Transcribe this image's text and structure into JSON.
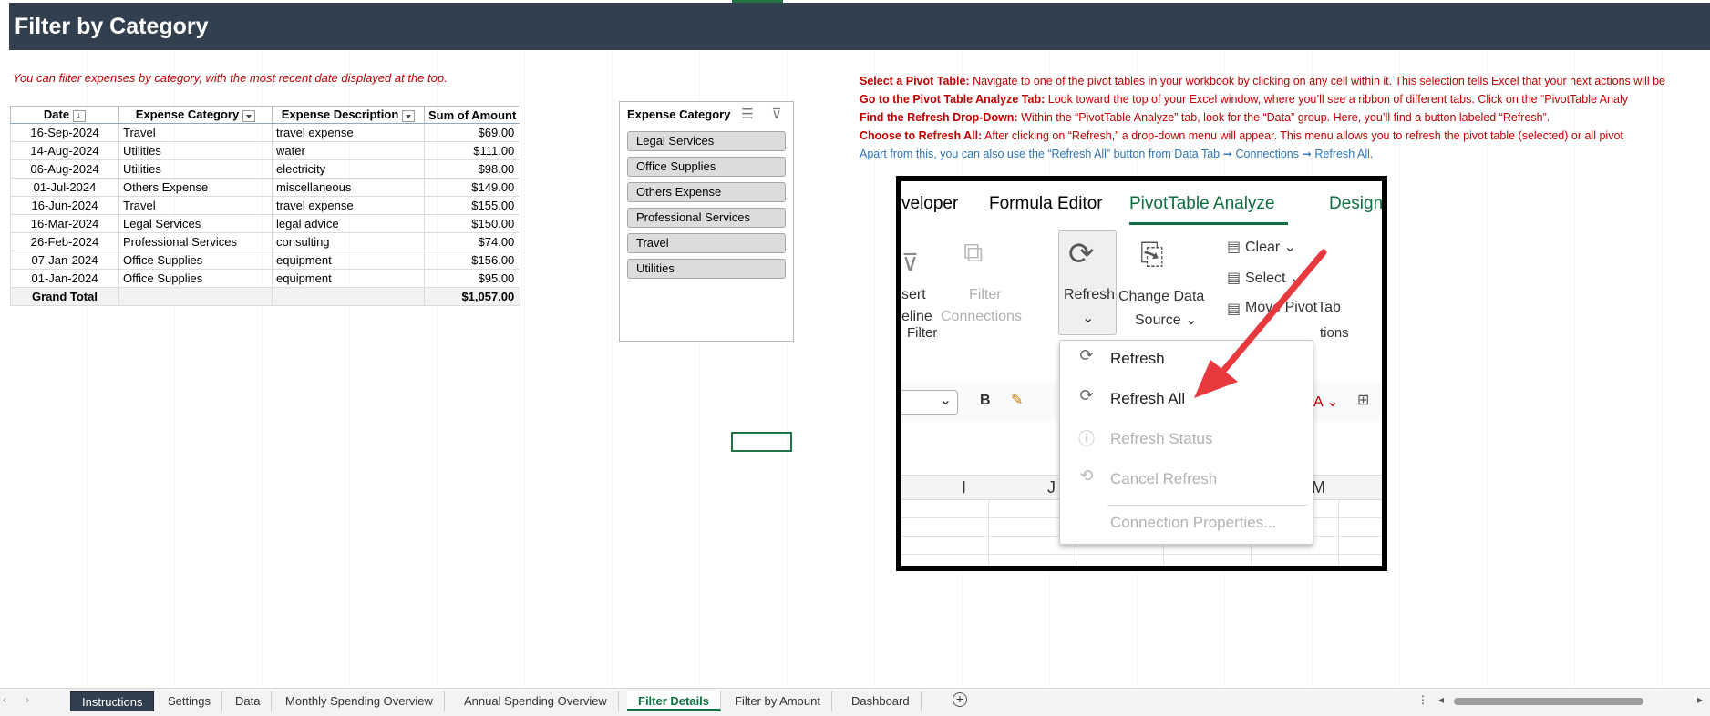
{
  "title": "Filter by Category",
  "subtitle": "You can filter expenses by category, with the most recent date displayed at the top.",
  "pivot": {
    "headers": [
      "Date",
      "Expense Category",
      "Expense Description",
      "Sum of Amount"
    ],
    "rows": [
      [
        "16-Sep-2024",
        "Travel",
        "travel expense",
        "$69.00"
      ],
      [
        "14-Aug-2024",
        "Utilities",
        "water",
        "$111.00"
      ],
      [
        "06-Aug-2024",
        "Utilities",
        "electricity",
        "$98.00"
      ],
      [
        "01-Jul-2024",
        "Others Expense",
        "miscellaneous",
        "$149.00"
      ],
      [
        "16-Jun-2024",
        "Travel",
        "travel expense",
        "$155.00"
      ],
      [
        "16-Mar-2024",
        "Legal Services",
        "legal advice",
        "$150.00"
      ],
      [
        "26-Feb-2024",
        "Professional Services",
        "consulting",
        "$74.00"
      ],
      [
        "07-Jan-2024",
        "Office Supplies",
        "equipment",
        "$156.00"
      ],
      [
        "01-Jan-2024",
        "Office Supplies",
        "equipment",
        "$95.00"
      ]
    ],
    "total_label": "Grand Total",
    "total_value": "$1,057.00"
  },
  "slicer": {
    "title": "Expense Category",
    "items": [
      "Legal Services",
      "Office Supplies",
      "Others Expense",
      "Professional Services",
      "Travel",
      "Utilities"
    ]
  },
  "instructions": [
    {
      "bold": "Select a Pivot Table:",
      "text": " Navigate to one of the pivot tables in your workbook by clicking on any cell within it. This selection tells Excel that your next actions will be"
    },
    {
      "bold": "Go to the Pivot Table Analyze Tab:",
      "text": " Look toward the top of your Excel window, where you’ll see a ribbon of different tabs. Click on the “PivotTable Analy"
    },
    {
      "bold": "Find the Refresh Drop-Down:",
      "text": " Within the “PivotTable Analyze” tab, look for the “Data” group. Here, you’ll find a button labeled “Refresh”."
    },
    {
      "bold": "Choose to Refresh All:",
      "text": " After clicking on “Refresh,” a drop-down menu will appear. This menu allows you to refresh the pivot table (selected) or all pivot"
    }
  ],
  "instructions_note": "Apart from this, you can also use the “Refresh All” button from Data Tab ➞ Connections ➞ Refresh All.",
  "screenshot": {
    "tabs": {
      "developer": "veloper",
      "formula_editor": "Formula Editor",
      "pivot_analyze": "PivotTable Analyze",
      "design": "Design"
    },
    "insert_timeline": [
      "sert",
      "eline"
    ],
    "filter_connections": [
      "Filter",
      "Connections"
    ],
    "refresh": "Refresh",
    "change_data_source": [
      "Change Data",
      "Source ⌄"
    ],
    "clear": "Clear ⌄",
    "select": "Select ⌄",
    "move_pivot": "Move PivotTab",
    "actions": "tions",
    "filter_group": "Filter",
    "menu": {
      "refresh": "Refresh",
      "refresh_all": "Refresh All",
      "refresh_status": "Refresh Status",
      "cancel_refresh": "Cancel Refresh",
      "connection_properties": "Connection Properties..."
    },
    "columns": [
      "I",
      "J",
      "M"
    ],
    "colors": {
      "accent": "#0e6f3f",
      "arrow": "#e8393f"
    }
  },
  "sheets": [
    "Instructions",
    "Settings",
    "Data",
    "Monthly Spending Overview",
    "Annual Spending Overview",
    "Filter Details",
    "Filter by Amount",
    "Dashboard"
  ],
  "active_sheet": "Filter Details",
  "colors": {
    "title_bg": "#323f4f",
    "instruction_red": "#c00000",
    "instruction_blue": "#2e75b6"
  }
}
